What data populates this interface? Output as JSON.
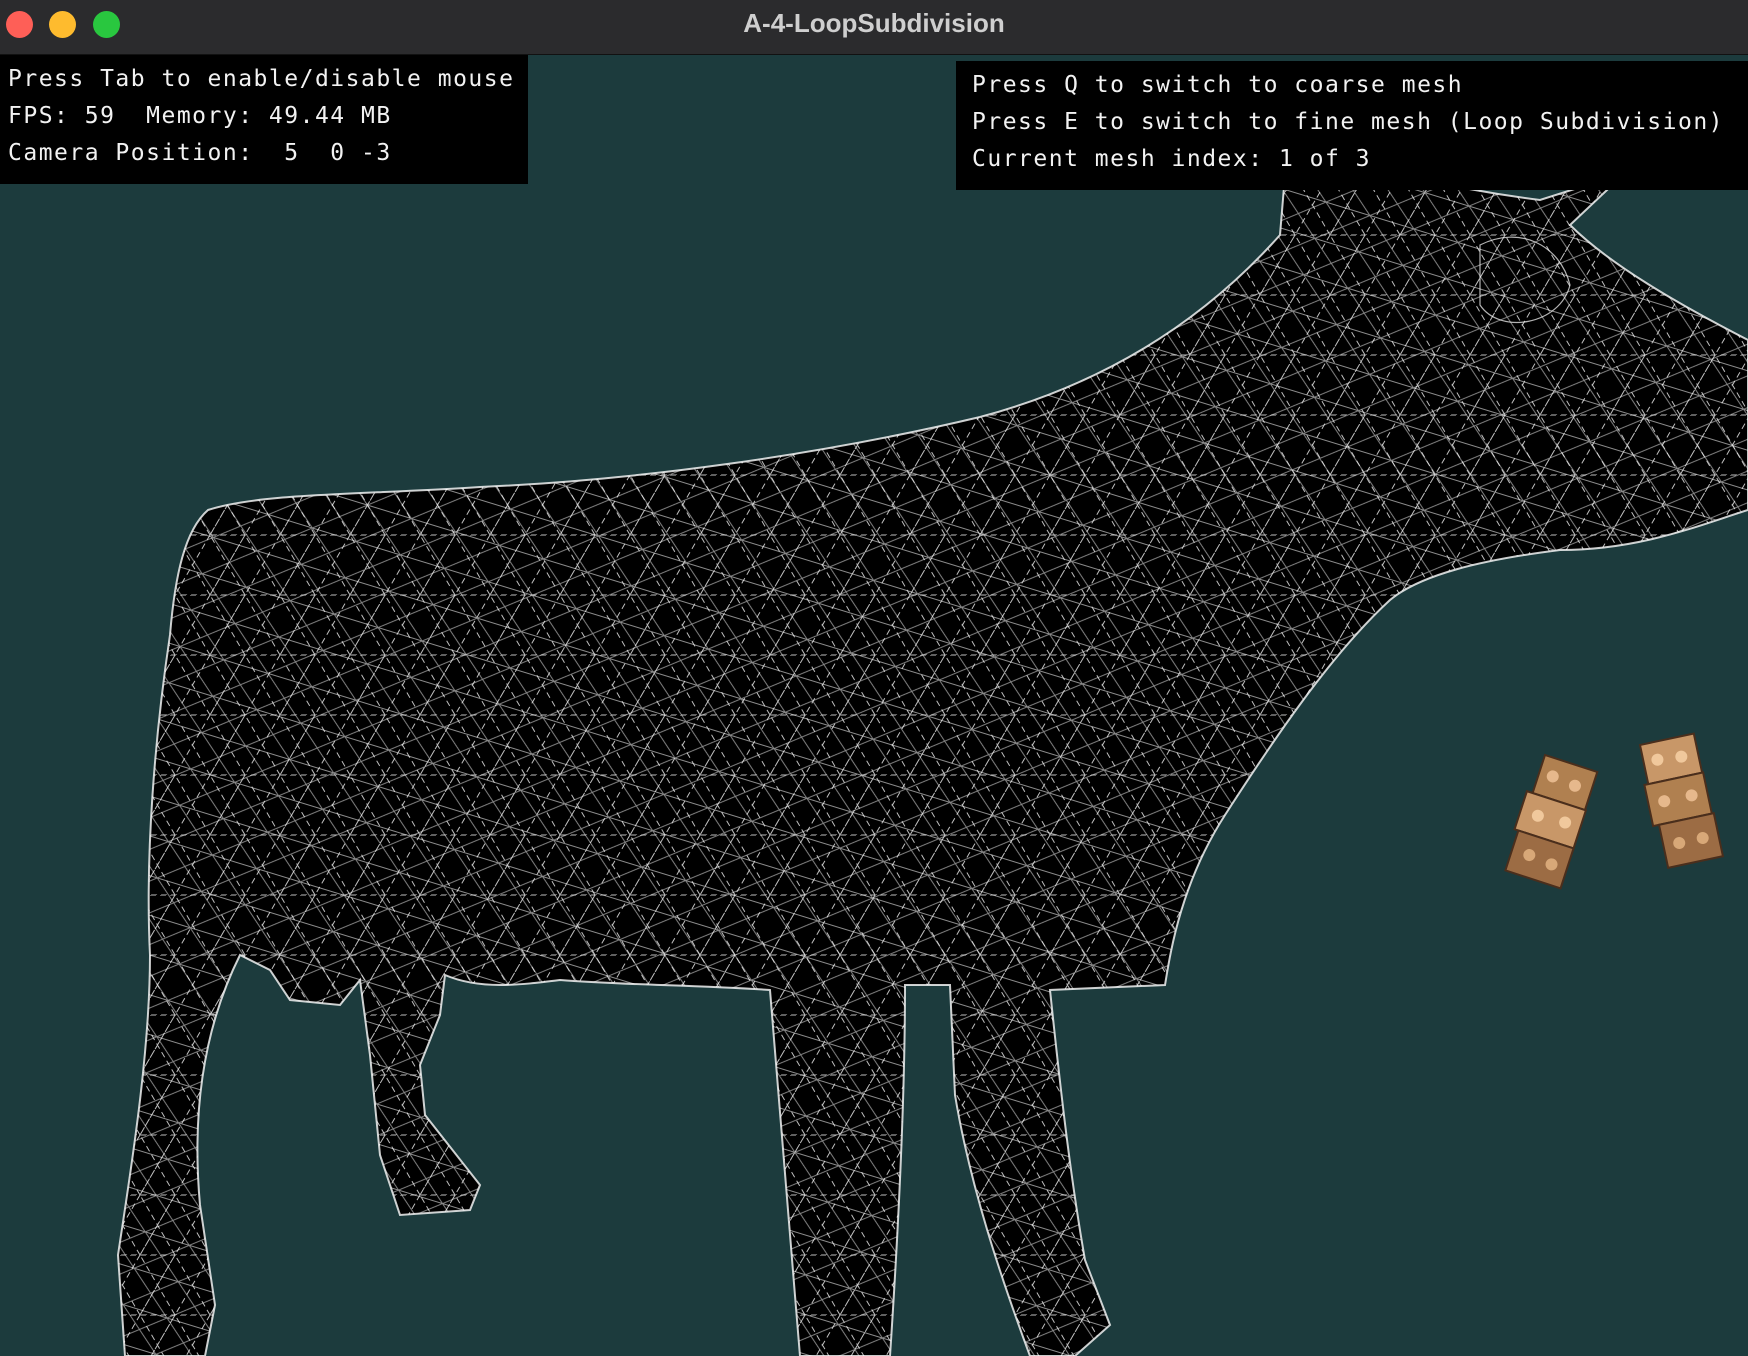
{
  "window": {
    "title": "A-4-LoopSubdivision"
  },
  "overlay_left": {
    "line1": "Press Tab to enable/disable mouse",
    "line2": "FPS: 59  Memory: 49.44 MB",
    "line3": "Camera Position:  5  0 -3"
  },
  "overlay_right": {
    "line1": "Press Q to switch to coarse mesh",
    "line2": "Press E to switch to fine mesh (Loop Subdivision)",
    "line3": "Current mesh index: 1 of 3"
  },
  "colors": {
    "background": "#1c3b3d",
    "mesh_fill": "#000000",
    "wireframe": "#ffffff",
    "overlay_bg": "#000000"
  }
}
